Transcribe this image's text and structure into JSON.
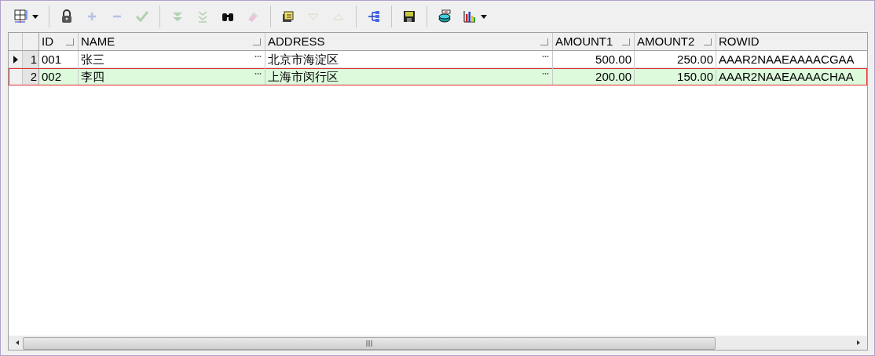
{
  "toolbar": [
    [
      {
        "kind": "grid",
        "disabled": false,
        "dropdown": true
      }
    ],
    [
      {
        "kind": "lock",
        "disabled": false,
        "dropdown": false
      },
      {
        "kind": "plus",
        "disabled": true,
        "dropdown": false
      },
      {
        "kind": "minus",
        "disabled": true,
        "dropdown": false
      },
      {
        "kind": "check",
        "disabled": true,
        "dropdown": false
      }
    ],
    [
      {
        "kind": "down-double",
        "disabled": true,
        "dropdown": false
      },
      {
        "kind": "down-bar",
        "disabled": true,
        "dropdown": false
      },
      {
        "kind": "binoculars",
        "disabled": false,
        "dropdown": false
      },
      {
        "kind": "eraser",
        "disabled": true,
        "dropdown": false
      }
    ],
    [
      {
        "kind": "stack",
        "disabled": false,
        "dropdown": false
      },
      {
        "kind": "triangle-down",
        "disabled": true,
        "dropdown": false
      },
      {
        "kind": "triangle-up",
        "disabled": true,
        "dropdown": false
      }
    ],
    [
      {
        "kind": "tree",
        "disabled": false,
        "dropdown": false
      }
    ],
    [
      {
        "kind": "save",
        "disabled": false,
        "dropdown": false
      }
    ],
    [
      {
        "kind": "database",
        "disabled": false,
        "dropdown": false
      },
      {
        "kind": "chart",
        "disabled": false,
        "dropdown": true
      }
    ]
  ],
  "table": {
    "columns": [
      {
        "label": "ID",
        "kind": "text"
      },
      {
        "label": "NAME",
        "kind": "lookup"
      },
      {
        "label": "ADDRESS",
        "kind": "lookup"
      },
      {
        "label": "AMOUNT1",
        "kind": "number"
      },
      {
        "label": "AMOUNT2",
        "kind": "number"
      },
      {
        "label": "ROWID",
        "kind": "text"
      }
    ],
    "rows": [
      {
        "number": "1",
        "current": true,
        "selected": false,
        "cells": [
          "001",
          "张三",
          "北京市海淀区",
          "500.00",
          "250.00",
          "AAAR2NAAEAAAACGAA"
        ]
      },
      {
        "number": "2",
        "current": false,
        "selected": true,
        "cells": [
          "002",
          "李四",
          "上海市闵行区",
          "200.00",
          "150.00",
          "AAAR2NAAEAAAACHAA"
        ]
      }
    ]
  }
}
